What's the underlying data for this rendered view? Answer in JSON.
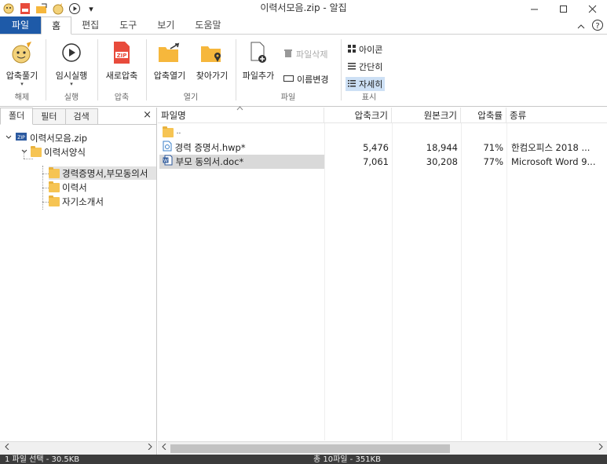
{
  "window": {
    "title": "이력서모음.zip - 알집",
    "qat_dropdown": "▾"
  },
  "tabs": [
    {
      "label": "파일"
    },
    {
      "label": "홈"
    },
    {
      "label": "편집"
    },
    {
      "label": "도구"
    },
    {
      "label": "보기"
    },
    {
      "label": "도움말"
    }
  ],
  "ribbon": {
    "extract": {
      "label": "압축풀기",
      "group": "해제"
    },
    "run": {
      "label": "임시실행",
      "group": "실행"
    },
    "new_zip": {
      "label": "새로압축",
      "group": "압축",
      "icon_text": "ZIP"
    },
    "open_zip": {
      "label": "압축열기"
    },
    "find": {
      "label": "찾아가기"
    },
    "open_group": "열기",
    "add_file": {
      "label": "파일추가"
    },
    "delete_file": {
      "label": "파일삭제"
    },
    "rename": {
      "label": "이름변경"
    },
    "file_group": "파일",
    "view_icons": {
      "label": "아이콘"
    },
    "view_simple": {
      "label": "간단히"
    },
    "view_detail": {
      "label": "자세히"
    },
    "view_group": "표시"
  },
  "left_panel": {
    "tabs": [
      {
        "label": "폴더"
      },
      {
        "label": "필터"
      },
      {
        "label": "검색"
      }
    ],
    "close": "×",
    "tree": {
      "root": "이력서모음.zip",
      "folder1": "이력서양식",
      "child1": "경력증명서,부모동의서",
      "child2": "이력서",
      "child3": "자기소개서"
    }
  },
  "file_list": {
    "columns": [
      "파일명",
      "압축크기",
      "원본크기",
      "압축률",
      "종류"
    ],
    "parent": "..",
    "rows": [
      {
        "name": "경력 증명서.hwp*",
        "packed": "5,476",
        "original": "18,944",
        "ratio": "71%",
        "type": "한컴오피스 2018 ...",
        "icon": "hwp-file-icon"
      },
      {
        "name": "부모 동의서.doc*",
        "packed": "7,061",
        "original": "30,208",
        "ratio": "77%",
        "type": "Microsoft Word 9...",
        "icon": "word-file-icon"
      }
    ]
  },
  "status": {
    "left": "1 파일 선택 - 30.5KB",
    "right": "총 10파일 - 351KB"
  },
  "colors": {
    "file_tab": "#1e5aa8",
    "selection": "#cde0f5",
    "folder": "#f6c453",
    "statusbar": "#3c3c3c"
  }
}
